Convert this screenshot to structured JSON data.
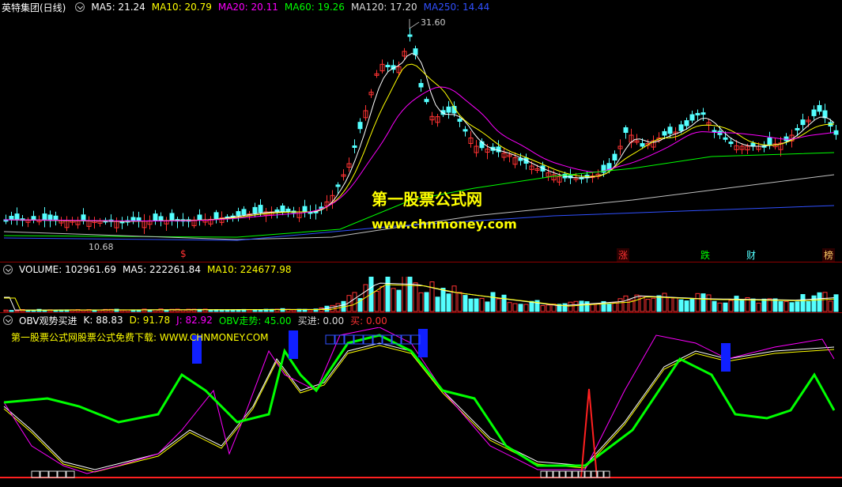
{
  "colors": {
    "bg": "#000000",
    "up": "#ff3232",
    "down": "#54ffff",
    "ma5": "#ffffff",
    "ma10": "#ffff00",
    "ma20": "#ff00ff",
    "ma60": "#00ff00",
    "ma120": "#c0c0c0",
    "ma250": "#3050ff",
    "sep": "#8b0000"
  },
  "price_panel": {
    "title": "英特集团(日线)",
    "ma5": "MA5: 21.24",
    "ma10": "MA10: 20.79",
    "ma20": "MA20: 20.11",
    "ma60": "MA60: 19.26",
    "ma120": "MA120: 17.20",
    "ma250": "MA250: 14.44",
    "high_label": "31.60",
    "low_label": "10.68",
    "watermark_cn": "第一股票公式网",
    "watermark_url": "www.chnmoney.com",
    "events": [
      "$",
      "涨",
      "跌",
      "财",
      "榜"
    ]
  },
  "volume_panel": {
    "title": "VOLUME: 102961.69",
    "ma5": "MA5: 222261.84",
    "ma10": "MA10: 224677.98"
  },
  "obv_panel": {
    "title": "OBV观势买进",
    "k": "K: 88.83",
    "d": "D: 91.78",
    "j": "J: 82.92",
    "trend": "OBV走势: 45.00",
    "buy_in": "买进: 0.00",
    "buy": "买: 0.00",
    "note": "第一股票公式网股票公式免费下载: WWW.CHNMONEY.COM"
  }
}
